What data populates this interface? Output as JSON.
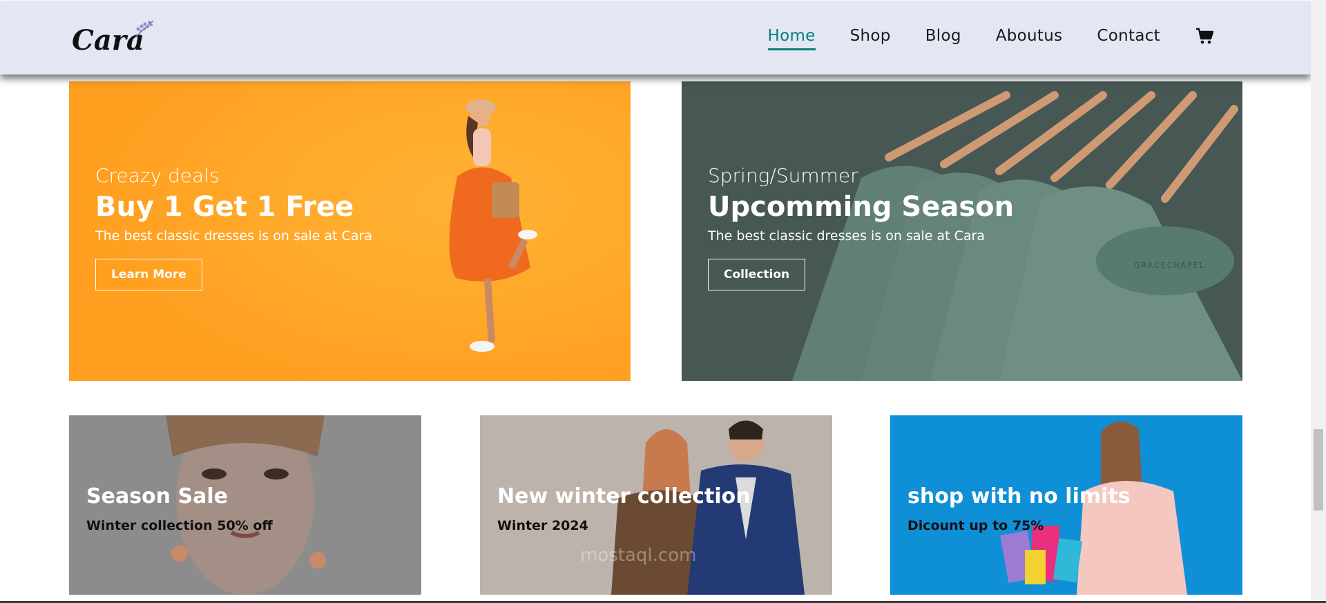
{
  "header": {
    "logo_text": "Cara",
    "nav": [
      {
        "label": "Home",
        "active": true
      },
      {
        "label": "Shop",
        "active": false
      },
      {
        "label": "Blog",
        "active": false
      },
      {
        "label": "Aboutus",
        "active": false
      },
      {
        "label": "Contact",
        "active": false
      }
    ],
    "cart_icon": "shopping-cart-icon",
    "background": "#e3e6f3",
    "active_color": "#088178"
  },
  "banners_big": [
    {
      "eyebrow": "Creazy deals",
      "title": "Buy 1 Get 1 Free",
      "description": "The best classic dresses is on sale at Cara",
      "button": "Learn More",
      "background": "#ffa925"
    },
    {
      "eyebrow": "Spring/Summer",
      "title": "Upcomming Season",
      "description": "The best classic dresses is on sale at Cara",
      "button": "Collection",
      "background": "#4f6762"
    }
  ],
  "banners_small": [
    {
      "title": "Season Sale",
      "subtitle": "Winter collection 50% off",
      "background": "#8b8b8b"
    },
    {
      "title": "New winter collection",
      "subtitle": "Winter 2024",
      "background": "#bdb5b0"
    },
    {
      "title": "shop with no limits",
      "subtitle": "Dicount up to 75%",
      "background": "#0f8fd6"
    }
  ],
  "watermark": "mostaql.com"
}
